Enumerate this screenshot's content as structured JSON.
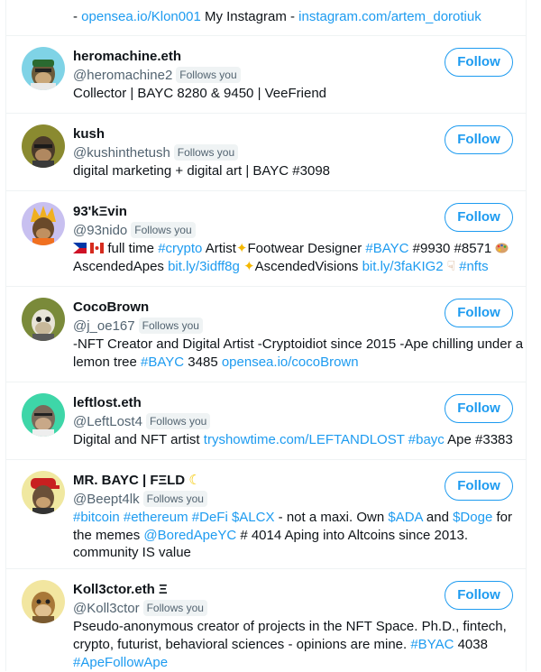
{
  "top_fragment": {
    "dash": "- ",
    "link1": "opensea.io/Klon001",
    "mid": " My Instagram - ",
    "link2": "instagram.com/artem_dorotiuk"
  },
  "follow_label": "Follow",
  "follows_you_label": "Follows you",
  "users": [
    {
      "name": "heromachine.eth",
      "handle": "@heromachine2",
      "bio_plain": "Collector | BAYC 8280 & 9450 | VeeFriend",
      "avatar_bg": "#7fd3e6"
    },
    {
      "name": "kush",
      "handle": "@kushinthetush",
      "bio_plain": "digital marketing + digital art | BAYC #3098",
      "avatar_bg": "#8a8a30"
    },
    {
      "name": "93'kΞvin",
      "handle": "@93nido",
      "bio_line1": {
        "t1": " full time ",
        "l1": "#crypto",
        "t2": " Artist",
        "t3": "Footwear Designer ",
        "l2": "#BAYC",
        "t4": " #9930 #8571 "
      },
      "bio_line2": {
        "t1": "AscendedApes ",
        "l1": "bit.ly/3idff8g",
        "t2": " ",
        "t3": "AscendedVisions ",
        "l2": "bit.ly/3faKIG2",
        "t4": " ",
        "l3": "#nfts"
      },
      "avatar_bg": "#c8c0f0"
    },
    {
      "name": "CocoBrown",
      "handle": "@j_oe167",
      "bio_line1": "-NFT Creator and Digital Artist -Cryptoidiot since 2015 -Ape chilling under a",
      "bio_line2": {
        "t1": "lemon tree ",
        "l1": "#BAYC",
        "t2": " 3485 ",
        "l2": "opensea.io/cocoBrown"
      },
      "avatar_bg": "#7a8a3a"
    },
    {
      "name": "leftlost.eth",
      "handle": "@LeftLost4",
      "bio": {
        "t1": "Digital and NFT artist ",
        "l1": "tryshowtime.com/LEFTANDLOST",
        "t2": " ",
        "l2": "#bayc",
        "t3": " Ape #3383"
      },
      "avatar_bg": "#3ed6a8"
    },
    {
      "name": "MR. BAYC | FΞLD",
      "handle": "@Beept4lk",
      "bio_line1": {
        "l1": "#bitcoin",
        "t1": " ",
        "l2": "#ethereum",
        "t2": " ",
        "l3": "#DeFi",
        "t3": " ",
        "l4": "$ALCX",
        "t4": " - not a maxi. Own ",
        "l5": "$ADA",
        "t5": " and ",
        "l6": "$Doge",
        "t6": " for"
      },
      "bio_line2": {
        "t1": "the memes ",
        "l1": "@BoredApeYC",
        "t2": " # 4014 Aping into Altcoins since 2013."
      },
      "bio_line3": "community IS value",
      "avatar_bg": "#f0e8a0"
    },
    {
      "name": "Koll3ctor.eth Ξ",
      "handle": "@Koll3ctor",
      "bio_line1": "Pseudo-anonymous creator of projects in the NFT Space. Ph.D., fintech,",
      "bio_line2": {
        "t1": "crypto, futurist, behavioral sciences - opinions are mine. ",
        "l1": "#BYAC",
        "t2": " 4038"
      },
      "bio_line3": {
        "l1": "#ApeFollowApe"
      },
      "avatar_bg": "#f2e6a0"
    }
  ]
}
